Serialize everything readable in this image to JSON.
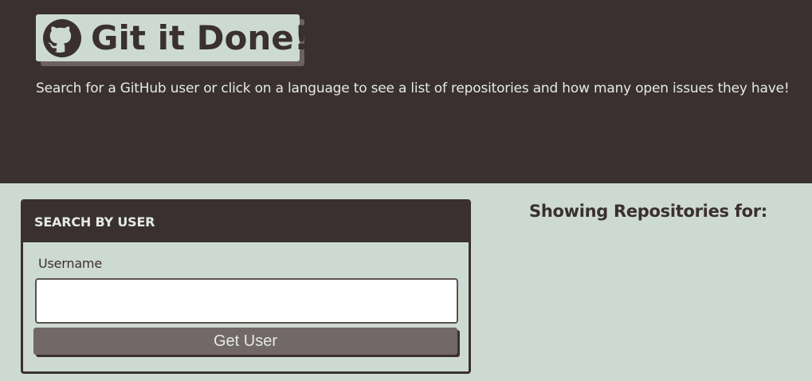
{
  "header": {
    "title": "Git it Done!",
    "subtitle": "Search for a GitHub user or click on a language to see a list of repositories and how many open issues they have!",
    "logo_icon": "github-icon"
  },
  "search_card": {
    "heading": "SEARCH BY USER",
    "username_label": "Username",
    "username_value": "",
    "username_placeholder": "",
    "submit_label": "Get User"
  },
  "results": {
    "heading": "Showing Repositories for:"
  },
  "colors": {
    "dark": "#3a3030",
    "light": "#cddad2",
    "button": "#726867",
    "text_light": "#e4eae6"
  }
}
